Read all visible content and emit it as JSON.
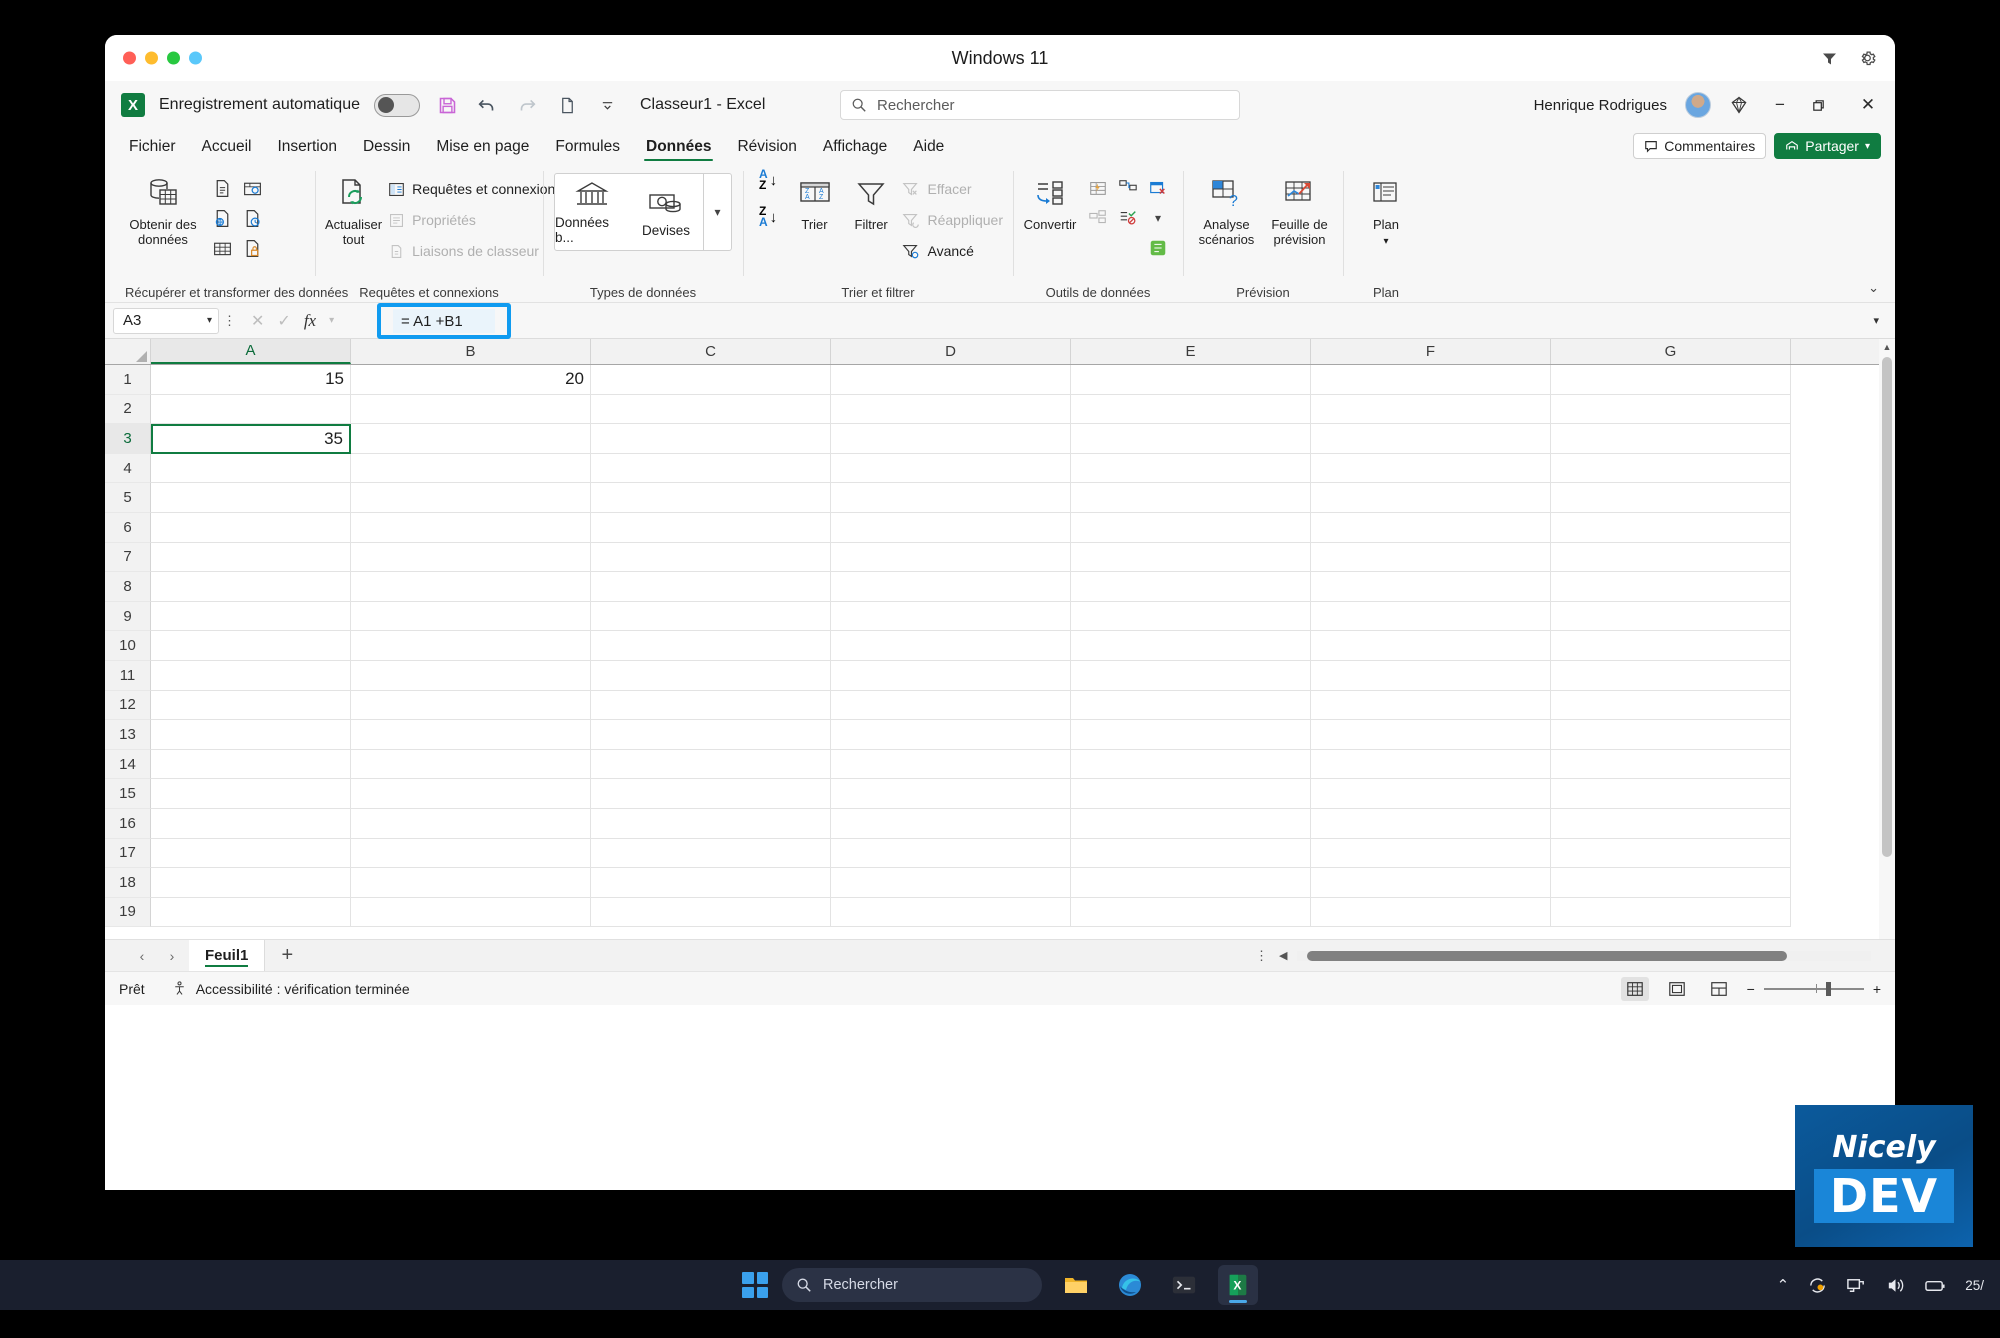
{
  "window": {
    "title": "Windows 11",
    "traffic_lights": [
      "close",
      "minimize",
      "maximize",
      "extra"
    ],
    "filter_icon": "filter-icon",
    "settings_icon": "gear-icon"
  },
  "quick_access": {
    "app_icon": "excel-logo-icon",
    "autosave_label": "Enregistrement automatique",
    "autosave_state": "off",
    "icons": [
      "save-icon",
      "undo-icon",
      "redo-icon",
      "new-doc-icon",
      "customize-qat-icon"
    ],
    "document_title": "Classeur1  -  Excel",
    "search": {
      "placeholder": "Rechercher",
      "icon": "search-icon"
    },
    "user_name": "Henrique Rodrigues",
    "avatar": "user-avatar",
    "diamond_icon": "diamond-icon",
    "window_controls": [
      "minimize",
      "restore",
      "close"
    ]
  },
  "ribbon": {
    "tabs": [
      {
        "label": "Fichier",
        "active": false
      },
      {
        "label": "Accueil",
        "active": false
      },
      {
        "label": "Insertion",
        "active": false
      },
      {
        "label": "Dessin",
        "active": false
      },
      {
        "label": "Mise en page",
        "active": false
      },
      {
        "label": "Formules",
        "active": false
      },
      {
        "label": "Données",
        "active": true
      },
      {
        "label": "Révision",
        "active": false
      },
      {
        "label": "Affichage",
        "active": false
      },
      {
        "label": "Aide",
        "active": false
      }
    ],
    "comments_button": "Commentaires",
    "share_button": "Partager",
    "collapse_icon": "chevron-up-icon",
    "groups": [
      {
        "name": "Récupérer et transformer des données",
        "big_button": "Obtenir des données",
        "small_icons": [
          "from-text-csv-icon",
          "from-table-range-icon",
          "from-web-icon",
          "from-recent-sources-icon",
          "from-existing-connections-icon",
          "from-picture-icon"
        ]
      },
      {
        "name": "Requêtes et connexions",
        "big_button": "Actualiser tout",
        "rows": [
          {
            "label": "Requêtes et connexions",
            "disabled": false
          },
          {
            "label": "Propriétés",
            "disabled": true
          },
          {
            "label": "Liaisons de classeur",
            "disabled": true
          }
        ]
      },
      {
        "name": "Types de données",
        "items": [
          {
            "label": "Données b...",
            "icon": "bank-icon"
          },
          {
            "label": "Devises",
            "icon": "currency-icon"
          }
        ],
        "more_icon": "chevron-down-icon"
      },
      {
        "name": "Trier et filtrer",
        "sort_asc": "A-Z",
        "sort_desc": "Z-A",
        "items": [
          {
            "label": "Trier",
            "icon": "sort-icon"
          },
          {
            "label": "Filtrer",
            "icon": "funnel-icon"
          }
        ],
        "rows": [
          {
            "label": "Effacer",
            "disabled": true
          },
          {
            "label": "Réappliquer",
            "disabled": true
          },
          {
            "label": "Avancé",
            "disabled": false
          }
        ]
      },
      {
        "name": "Outils de données",
        "big_button": "Convertir",
        "small_icons": [
          "flash-fill-icon",
          "remove-duplicates-icon",
          "data-validation-icon",
          "relationships-icon",
          "consolidate-icon",
          "manage-model-icon"
        ]
      },
      {
        "name": "Prévision",
        "items": [
          {
            "label": "Analyse scénarios",
            "icon": "what-if-icon"
          },
          {
            "label": "Feuille de prévision",
            "icon": "forecast-sheet-icon"
          }
        ]
      },
      {
        "name": "Plan",
        "big_button": "Plan"
      }
    ]
  },
  "formula_bar": {
    "name_box_value": "A3",
    "cancel_icon": "cancel-icon",
    "enter_icon": "check-icon",
    "function_icon": "fx-icon",
    "formula_value": "=  A1  +B1",
    "expand_icon": "chevron-down-icon",
    "highlighted": true,
    "highlight_color": "#109bf0"
  },
  "grid": {
    "columns": [
      "A",
      "B",
      "C",
      "D",
      "E",
      "F",
      "G"
    ],
    "selected_column": "A",
    "rows": [
      "1",
      "2",
      "3",
      "4",
      "5",
      "6",
      "7",
      "8",
      "9",
      "10",
      "11",
      "12",
      "13",
      "14",
      "15",
      "16",
      "17",
      "18",
      "19"
    ],
    "selected_row": "3",
    "cells": [
      {
        "ref": "A1",
        "row": 1,
        "col": 0,
        "value": "15"
      },
      {
        "ref": "B1",
        "row": 1,
        "col": 1,
        "value": "20"
      },
      {
        "ref": "A3",
        "row": 3,
        "col": 0,
        "value": "35",
        "selected": true
      }
    ]
  },
  "sheet_bar": {
    "prev_icon": "chevron-left-icon",
    "next_icon": "chevron-right-icon",
    "tabs": [
      {
        "label": "Feuil1",
        "active": true
      }
    ],
    "add_sheet_icon": "plus-icon"
  },
  "status_bar": {
    "status": "Prêt",
    "accessibility": "Accessibilité : vérification terminée",
    "accessibility_icon": "accessibility-icon",
    "views": [
      {
        "name": "normal-view",
        "active": true
      },
      {
        "name": "page-layout-view",
        "active": false
      },
      {
        "name": "page-break-view",
        "active": false
      }
    ],
    "zoom_out": "−",
    "zoom_in": "+"
  },
  "taskbar": {
    "start_icon": "windows-start-icon",
    "search": {
      "placeholder": "Rechercher",
      "icon": "search-icon"
    },
    "apps": [
      {
        "name": "file-explorer-icon",
        "active": false
      },
      {
        "name": "edge-browser-icon",
        "active": false
      },
      {
        "name": "terminal-icon",
        "active": false
      },
      {
        "name": "excel-icon",
        "active": true
      }
    ],
    "tray": {
      "chevron_icon": "chevron-up-icon",
      "sync_icon": "onedrive-sync-icon",
      "network_icon": "network-icon",
      "volume_icon": "volume-icon",
      "battery_icon": "battery-icon",
      "date": "25/"
    }
  },
  "watermark": {
    "line1": "Nicely",
    "line2": "DEV"
  }
}
